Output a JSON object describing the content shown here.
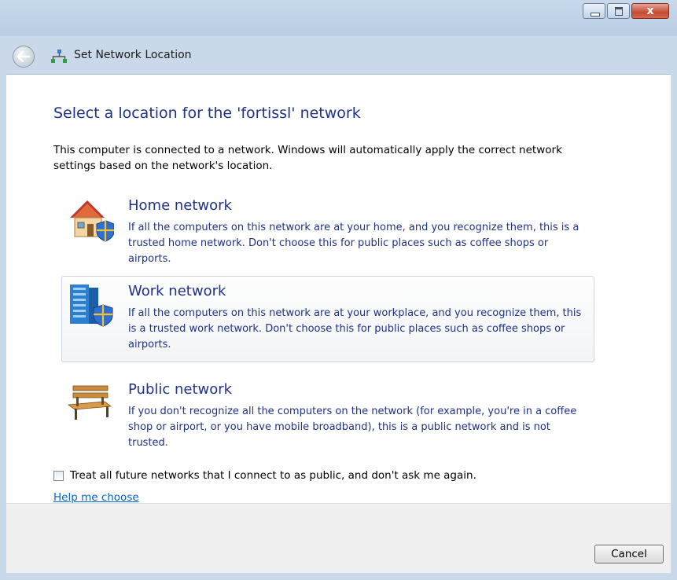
{
  "window": {
    "title": "Set Network Location",
    "close_glyph": "x"
  },
  "heading": "Select a location for the 'fortissl' network",
  "intro": "This computer is connected to a network. Windows will automatically apply the correct network settings based on the network's location.",
  "options": [
    {
      "title": "Home network",
      "description": "If all the computers on this network are at your home, and you recognize them, this is a trusted home network.  Don't choose this for public places such as coffee shops or airports.",
      "icon": "house-shield-icon"
    },
    {
      "title": "Work network",
      "description": "If all the computers on this network are at your workplace, and you recognize them, this is a trusted work network.  Don't choose this for public places such as coffee shops or airports.",
      "icon": "office-building-shield-icon"
    },
    {
      "title": "Public network",
      "description": "If you don't recognize all the computers on the network (for example, you're in a coffee shop or airport, or you have mobile broadband), this is a public network and is not trusted.",
      "icon": "park-bench-icon"
    }
  ],
  "checkbox": {
    "label": "Treat all future networks that I connect to as public, and don't ask me again.",
    "checked": false
  },
  "help_link": "Help me choose",
  "buttons": {
    "cancel": "Cancel"
  },
  "colors": {
    "link_blue": "#1e3287",
    "hyperlink": "#0066cc",
    "chrome": "#c9d9ea"
  }
}
